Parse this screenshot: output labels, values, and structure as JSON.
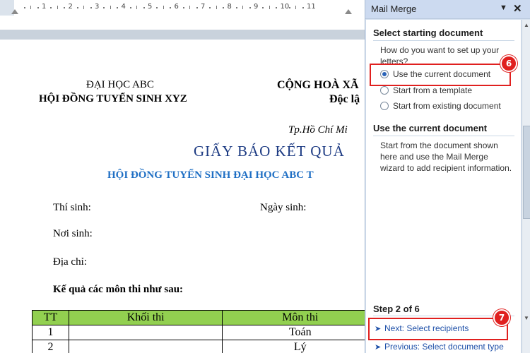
{
  "ruler": {
    "numbers": [
      "1",
      "2",
      "3",
      "4",
      "5",
      "6",
      "7",
      "8",
      "9",
      "10",
      "11"
    ],
    "icon": "ruler-icon"
  },
  "document": {
    "header_left_line1": "ĐẠI HỌC ABC",
    "header_left_line2": "HỘI ĐỒNG TUYỂN SINH XYZ",
    "header_right_line1": "CỘNG HOÀ XÃ",
    "header_right_line2": "Độc lậ",
    "place_date": "Tp.Hồ Chí Mi",
    "title": "GIẤY BÁO KẾT QUẢ",
    "subtitle": "HỘI ĐỒNG TUYỂN SINH ĐẠI HỌC ABC T",
    "label_candidate": "Thí sinh:",
    "label_dob": "Ngày sinh:",
    "label_birthplace": "Nơi sinh:",
    "label_address": "Địa chỉ:",
    "label_results": "Kế quả các môn thi như sau:",
    "table": {
      "headers": [
        "TT",
        "Khối thi",
        "Môn thi"
      ],
      "rows": [
        [
          "1",
          "",
          "Toán"
        ],
        [
          "2",
          "",
          "Lý"
        ]
      ]
    }
  },
  "pane": {
    "title": "Mail Merge",
    "dropdown_icon": "chevron-down-icon",
    "close_icon": "close-icon",
    "section1_title": "Select starting document",
    "question": "How do you want to set up your letters?",
    "options": [
      {
        "label": "Use the current document",
        "selected": true
      },
      {
        "label": "Start from a template",
        "selected": false
      },
      {
        "label": "Start from existing document",
        "selected": false
      }
    ],
    "section2_title": "Use the current document",
    "description": "Start from the document shown here and use the Mail Merge wizard to add recipient information.",
    "step": "Step 2 of 6",
    "next_link": "Next: Select recipients",
    "prev_link": "Previous: Select document type",
    "badge_option": "6",
    "badge_next": "7",
    "highlight_color": "#e0201f",
    "link_color": "#1d4fa8"
  },
  "colors": {
    "title_blue": "#1d3b83",
    "subtitle_blue": "#1f6fc4",
    "table_header_green": "#92d050",
    "pane_bg": "#d6e2f0"
  }
}
